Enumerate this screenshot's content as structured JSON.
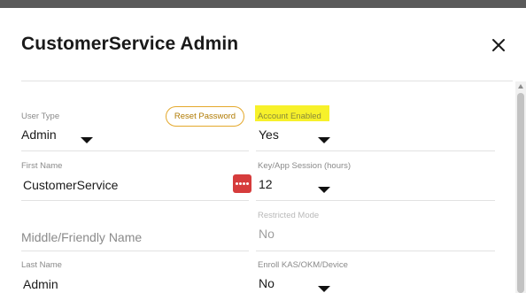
{
  "dialog": {
    "title": "CustomerService Admin",
    "close_icon": "close-icon"
  },
  "form": {
    "user_type": {
      "label": "User Type",
      "value": "Admin"
    },
    "reset_password": {
      "label": "Reset Password"
    },
    "account_enabled": {
      "label": "Account Enabled",
      "value": "Yes",
      "highlight_color": "#f7f12a"
    },
    "first_name": {
      "label": "First Name",
      "value": "CustomerService",
      "icon": "password-manager-icon"
    },
    "session_hours": {
      "label": "Key/App Session (hours)",
      "value": "12"
    },
    "restricted_mode": {
      "label": "Restricted Mode",
      "value": "No"
    },
    "middle_name": {
      "placeholder": "Middle/Friendly Name"
    },
    "last_name": {
      "label": "Last Name",
      "value": "Admin"
    },
    "enroll_device": {
      "label": "Enroll KAS/OKM/Device",
      "value": "No"
    }
  },
  "colors": {
    "accent": "#e4a82c",
    "icon_red": "#d63c3c",
    "top_bar": "#5a5a5a"
  }
}
